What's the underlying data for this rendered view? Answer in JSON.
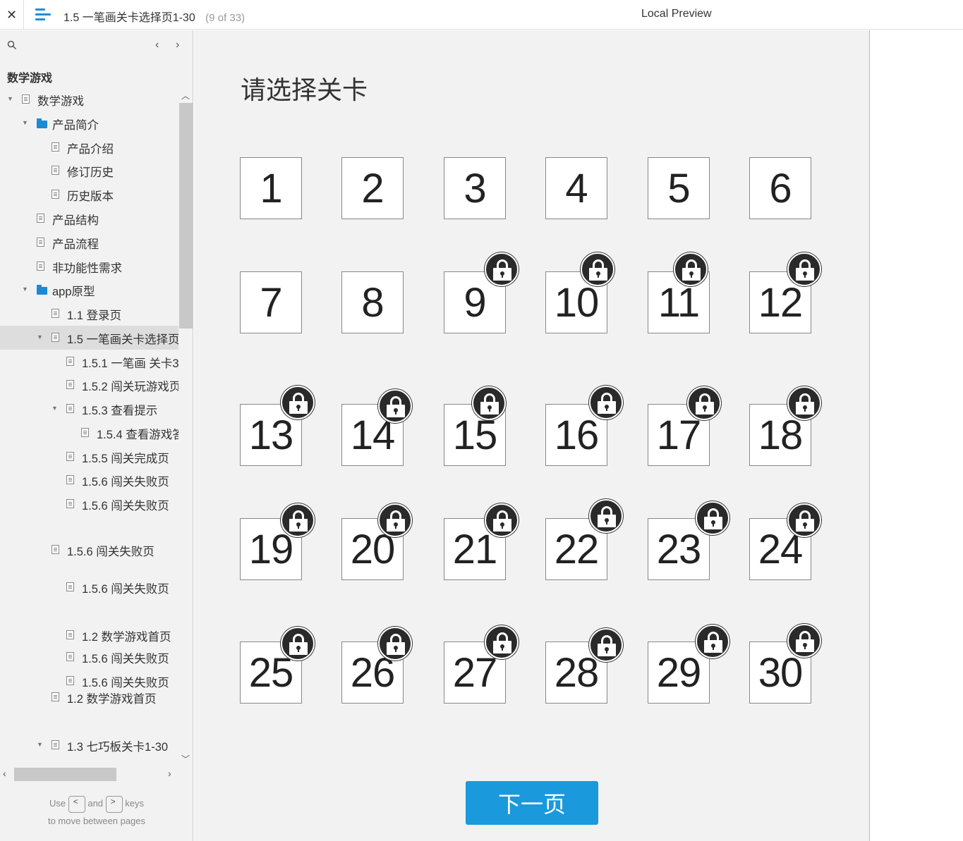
{
  "topbar": {
    "close_label": "✕",
    "title": "1.5 一笔画关卡选择页1-30",
    "page_count": "(9 of 33)",
    "preview_label": "Local Preview"
  },
  "sidebar": {
    "project_name": "数学游戏",
    "prev_label": "‹",
    "next_label": "›",
    "tree": [
      {
        "label": "数学游戏",
        "type": "page",
        "caret": "open"
      },
      {
        "label": "产品简介",
        "type": "folder",
        "caret": "open"
      },
      {
        "label": "产品介绍",
        "type": "page",
        "caret": ""
      },
      {
        "label": "修订历史",
        "type": "page",
        "caret": ""
      },
      {
        "label": "历史版本",
        "type": "page",
        "caret": ""
      },
      {
        "label": "产品结构",
        "type": "page",
        "caret": ""
      },
      {
        "label": "产品流程",
        "type": "page",
        "caret": ""
      },
      {
        "label": "非功能性需求",
        "type": "page",
        "caret": ""
      },
      {
        "label": "app原型",
        "type": "folder",
        "caret": "open"
      },
      {
        "label": "1.1 登录页",
        "type": "page",
        "caret": ""
      },
      {
        "label": "1.5 一笔画关卡选择页",
        "type": "page",
        "caret": "open",
        "selected": true
      },
      {
        "label": "1.5.1 一笔画 关卡3",
        "type": "page",
        "caret": ""
      },
      {
        "label": "1.5.2 闯关玩游戏页",
        "type": "page",
        "caret": ""
      },
      {
        "label": "1.5.3 查看提示",
        "type": "page",
        "caret": "open"
      },
      {
        "label": "1.5.4 查看游戏答",
        "type": "page",
        "caret": ""
      },
      {
        "label": "1.5.5 闯关完成页",
        "type": "page",
        "caret": ""
      },
      {
        "label": "1.5.6 闯关失败页",
        "type": "page",
        "caret": ""
      },
      {
        "label": "1.5.6 闯关失败页",
        "type": "page",
        "caret": ""
      },
      {
        "label": "1.5.6 闯关失败页",
        "type": "page",
        "caret": ""
      },
      {
        "label": "1.5.6 闯关失败页",
        "type": "page",
        "caret": ""
      },
      {
        "label": "1.2 数学游戏首页",
        "type": "page",
        "caret": ""
      },
      {
        "label": "1.5.6 闯关失败页",
        "type": "page",
        "caret": ""
      },
      {
        "label": "1.5.6 闯关失败页",
        "type": "page",
        "caret": ""
      },
      {
        "label": "1.2 数学游戏首页",
        "type": "page",
        "caret": ""
      },
      {
        "label": "1.3 七巧板关卡1-30",
        "type": "page",
        "caret": "open"
      }
    ],
    "hint_use": "Use",
    "hint_and": "and",
    "hint_keys": "keys",
    "hint_line2": "to move between pages",
    "key_left": "<",
    "key_right": ">"
  },
  "main": {
    "heading": "请选择关卡",
    "next_button": "下一页",
    "levels": [
      {
        "num": "1",
        "locked": false
      },
      {
        "num": "2",
        "locked": false
      },
      {
        "num": "3",
        "locked": false
      },
      {
        "num": "4",
        "locked": false
      },
      {
        "num": "5",
        "locked": false
      },
      {
        "num": "6",
        "locked": false
      },
      {
        "num": "7",
        "locked": false
      },
      {
        "num": "8",
        "locked": false
      },
      {
        "num": "9",
        "locked": true
      },
      {
        "num": "10",
        "locked": true
      },
      {
        "num": "11",
        "locked": true
      },
      {
        "num": "12",
        "locked": true
      },
      {
        "num": "13",
        "locked": true
      },
      {
        "num": "14",
        "locked": true
      },
      {
        "num": "15",
        "locked": true
      },
      {
        "num": "16",
        "locked": true
      },
      {
        "num": "17",
        "locked": true
      },
      {
        "num": "18",
        "locked": true
      },
      {
        "num": "19",
        "locked": true
      },
      {
        "num": "20",
        "locked": true
      },
      {
        "num": "21",
        "locked": true
      },
      {
        "num": "22",
        "locked": true
      },
      {
        "num": "23",
        "locked": true
      },
      {
        "num": "24",
        "locked": true
      },
      {
        "num": "25",
        "locked": true
      },
      {
        "num": "26",
        "locked": true
      },
      {
        "num": "27",
        "locked": true
      },
      {
        "num": "28",
        "locked": true
      },
      {
        "num": "29",
        "locked": true
      },
      {
        "num": "30",
        "locked": true
      }
    ]
  }
}
